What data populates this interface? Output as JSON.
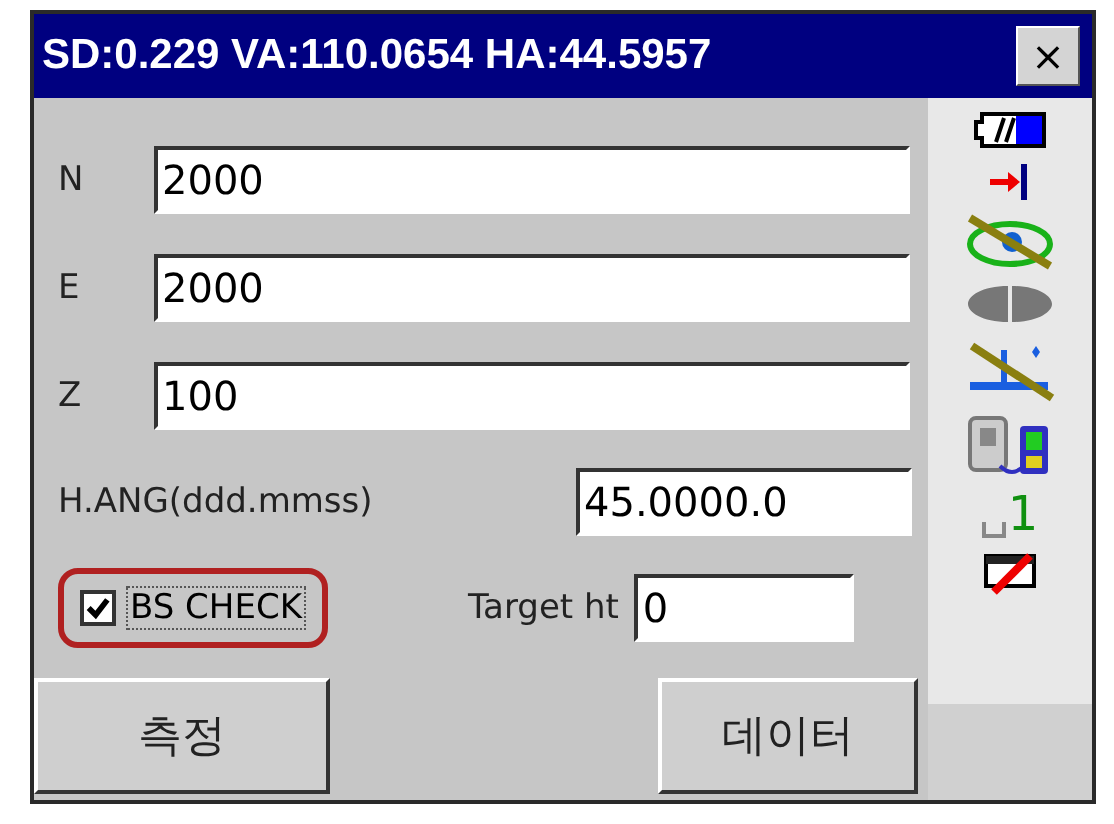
{
  "window": {
    "title": "SD:0.229 VA:110.0654 HA:44.5957",
    "close": "×"
  },
  "coordinates": [
    {
      "label": "N",
      "value": "2000"
    },
    {
      "label": "E",
      "value": "2000"
    },
    {
      "label": "Z",
      "value": "100"
    }
  ],
  "h_angle": {
    "label": "H.ANG(ddd.mmss)",
    "value": "45.0000.0"
  },
  "bs_check": {
    "label": "BS CHECK",
    "checked": true,
    "highlighted": true
  },
  "target_height": {
    "label": "Target ht",
    "value": "0"
  },
  "buttons": [
    "측정",
    "데이터"
  ],
  "status_icons": {
    "prism_count": "1"
  }
}
